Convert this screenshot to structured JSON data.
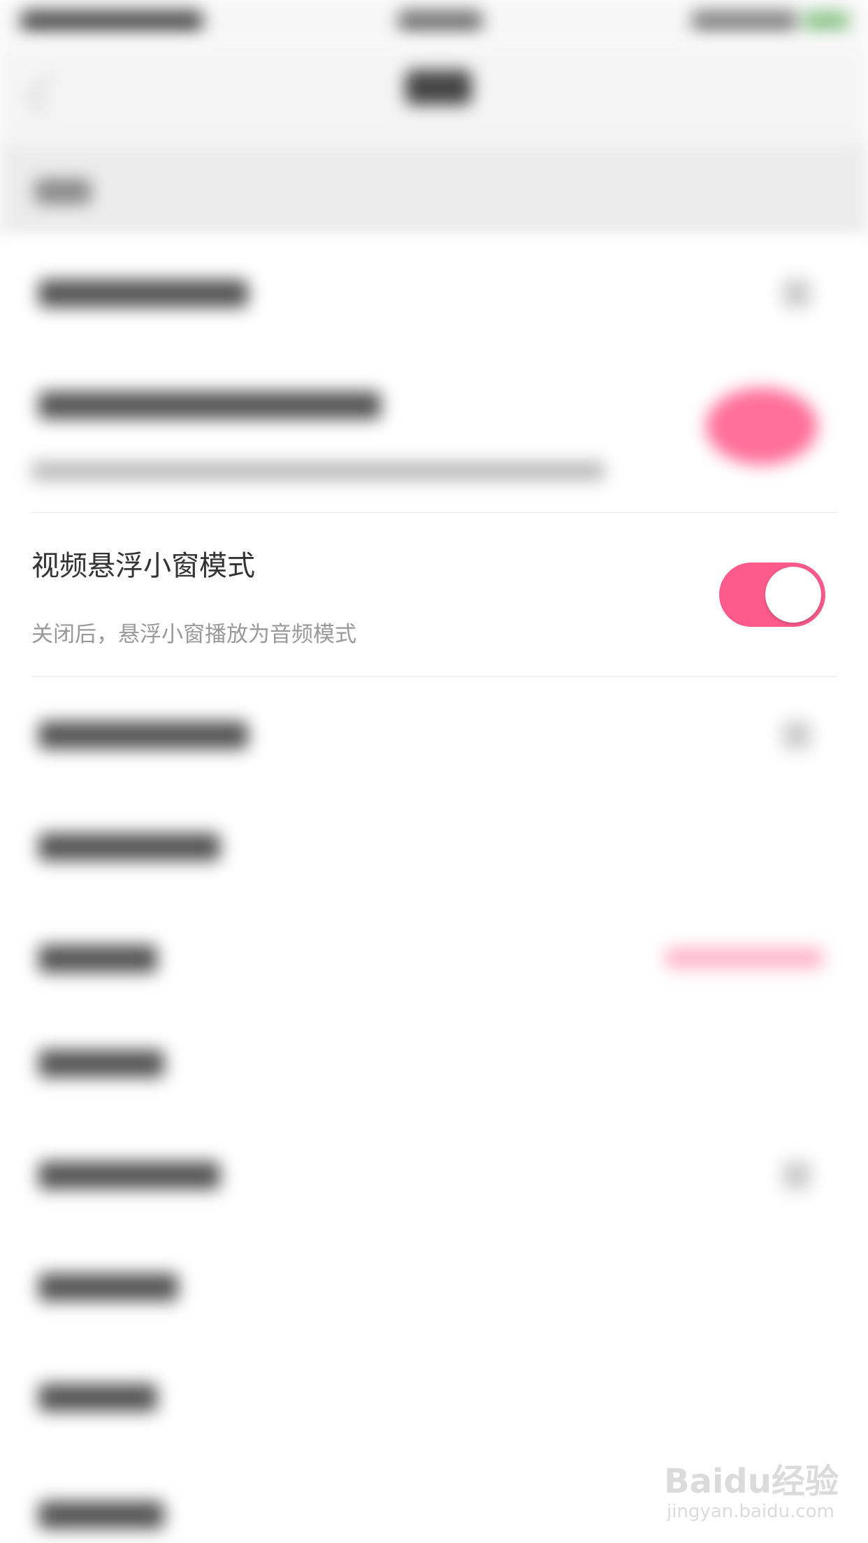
{
  "settings": {
    "video_floating_window": {
      "title": "视频悬浮小窗模式",
      "subtitle": "关闭后，悬浮小窗播放为音频模式",
      "enabled": true
    }
  },
  "colors": {
    "accent": "#fb5a8b",
    "toggle_knob": "#ffffff",
    "title_text": "#333333",
    "subtitle_text": "#999999",
    "divider": "#e9e9e9"
  },
  "watermark": {
    "logo": "Baidu经验",
    "url": "jingyan.baidu.com"
  }
}
